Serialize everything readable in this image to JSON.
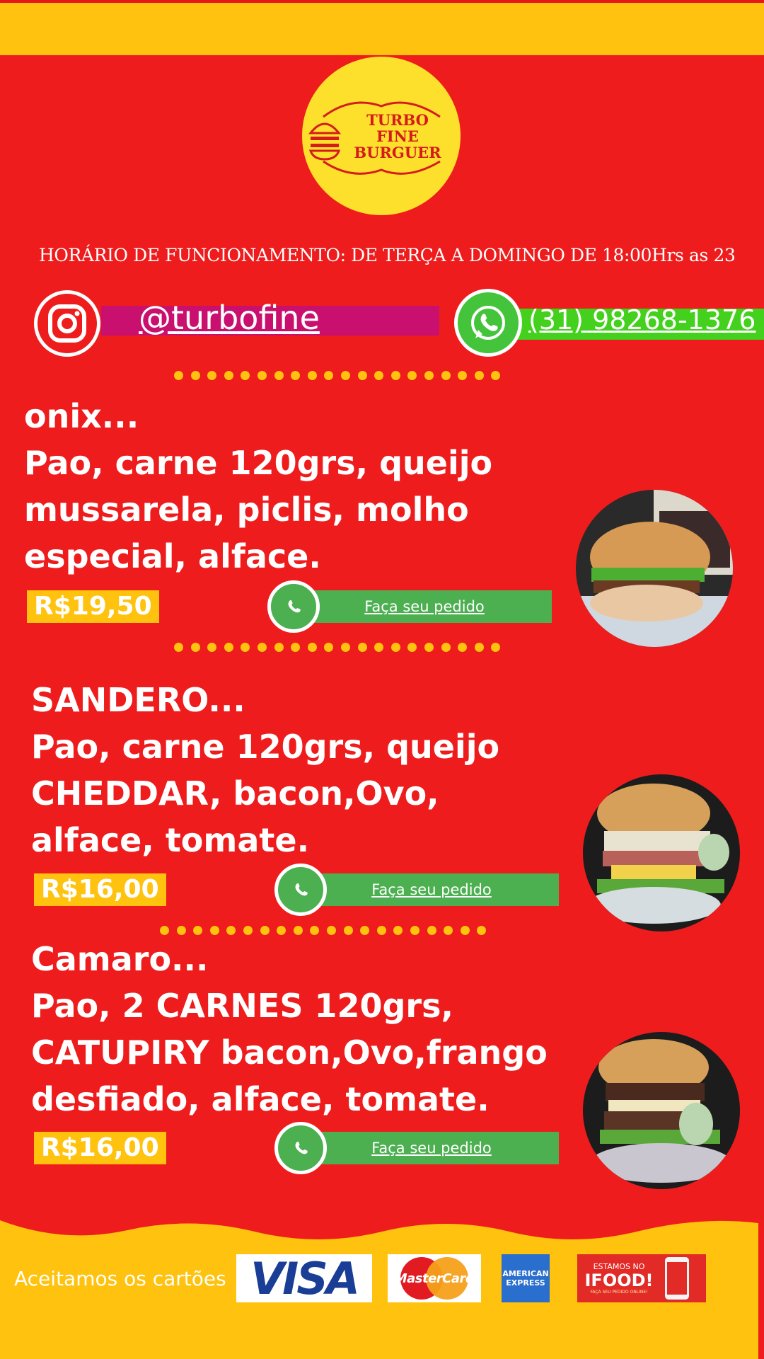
{
  "logo": {
    "line1": "TURBO",
    "line2": "FINE",
    "line3": "BURGUER"
  },
  "hours": "HORÁRIO DE FUNCIONAMENTO: DE TERÇA A DOMINGO DE 18:00Hrs as 23",
  "social": {
    "instagram": "@turbofine",
    "whatsapp": "(31) 98268-1376"
  },
  "menu": [
    {
      "name": "onix...",
      "lines": [
        "Pao, carne 120grs, queijo",
        "mussarela, piclis, molho",
        "especial, alface."
      ],
      "price": "R$19,50",
      "order_label": "Faça seu pedido"
    },
    {
      "name": "SANDERO...",
      "lines": [
        "Pao, carne 120grs, queijo",
        "CHEDDAR, bacon,Ovo,",
        "alface, tomate."
      ],
      "price": "R$16,00",
      "order_label": "Faça seu pedido"
    },
    {
      "name": "Camaro...",
      "lines": [
        "Pao,  2 CARNES 120grs,",
        "CATUPIRY bacon,Ovo,frango",
        "desfiado, alface, tomate."
      ],
      "price": "R$16,00",
      "order_label": "Faça seu pedido"
    }
  ],
  "footer": {
    "cards_label": "Aceitamos os cartões",
    "visa": "VISA",
    "mastercard": "MasterCard",
    "amex_line1": "AMERICAN",
    "amex_line2": "EXPRESS",
    "ifood_line1": "ESTAMOS NO",
    "ifood_line2": "IFOOD!",
    "ifood_line3": "FAÇA SEU PEDIDO ONLINE!"
  },
  "colors": {
    "background": "#ee1c1c",
    "accent_yellow": "#ffc20e",
    "instagram_bar": "#c9106e",
    "whatsapp_bar": "#43d11e",
    "order_bar": "#4caf50"
  }
}
